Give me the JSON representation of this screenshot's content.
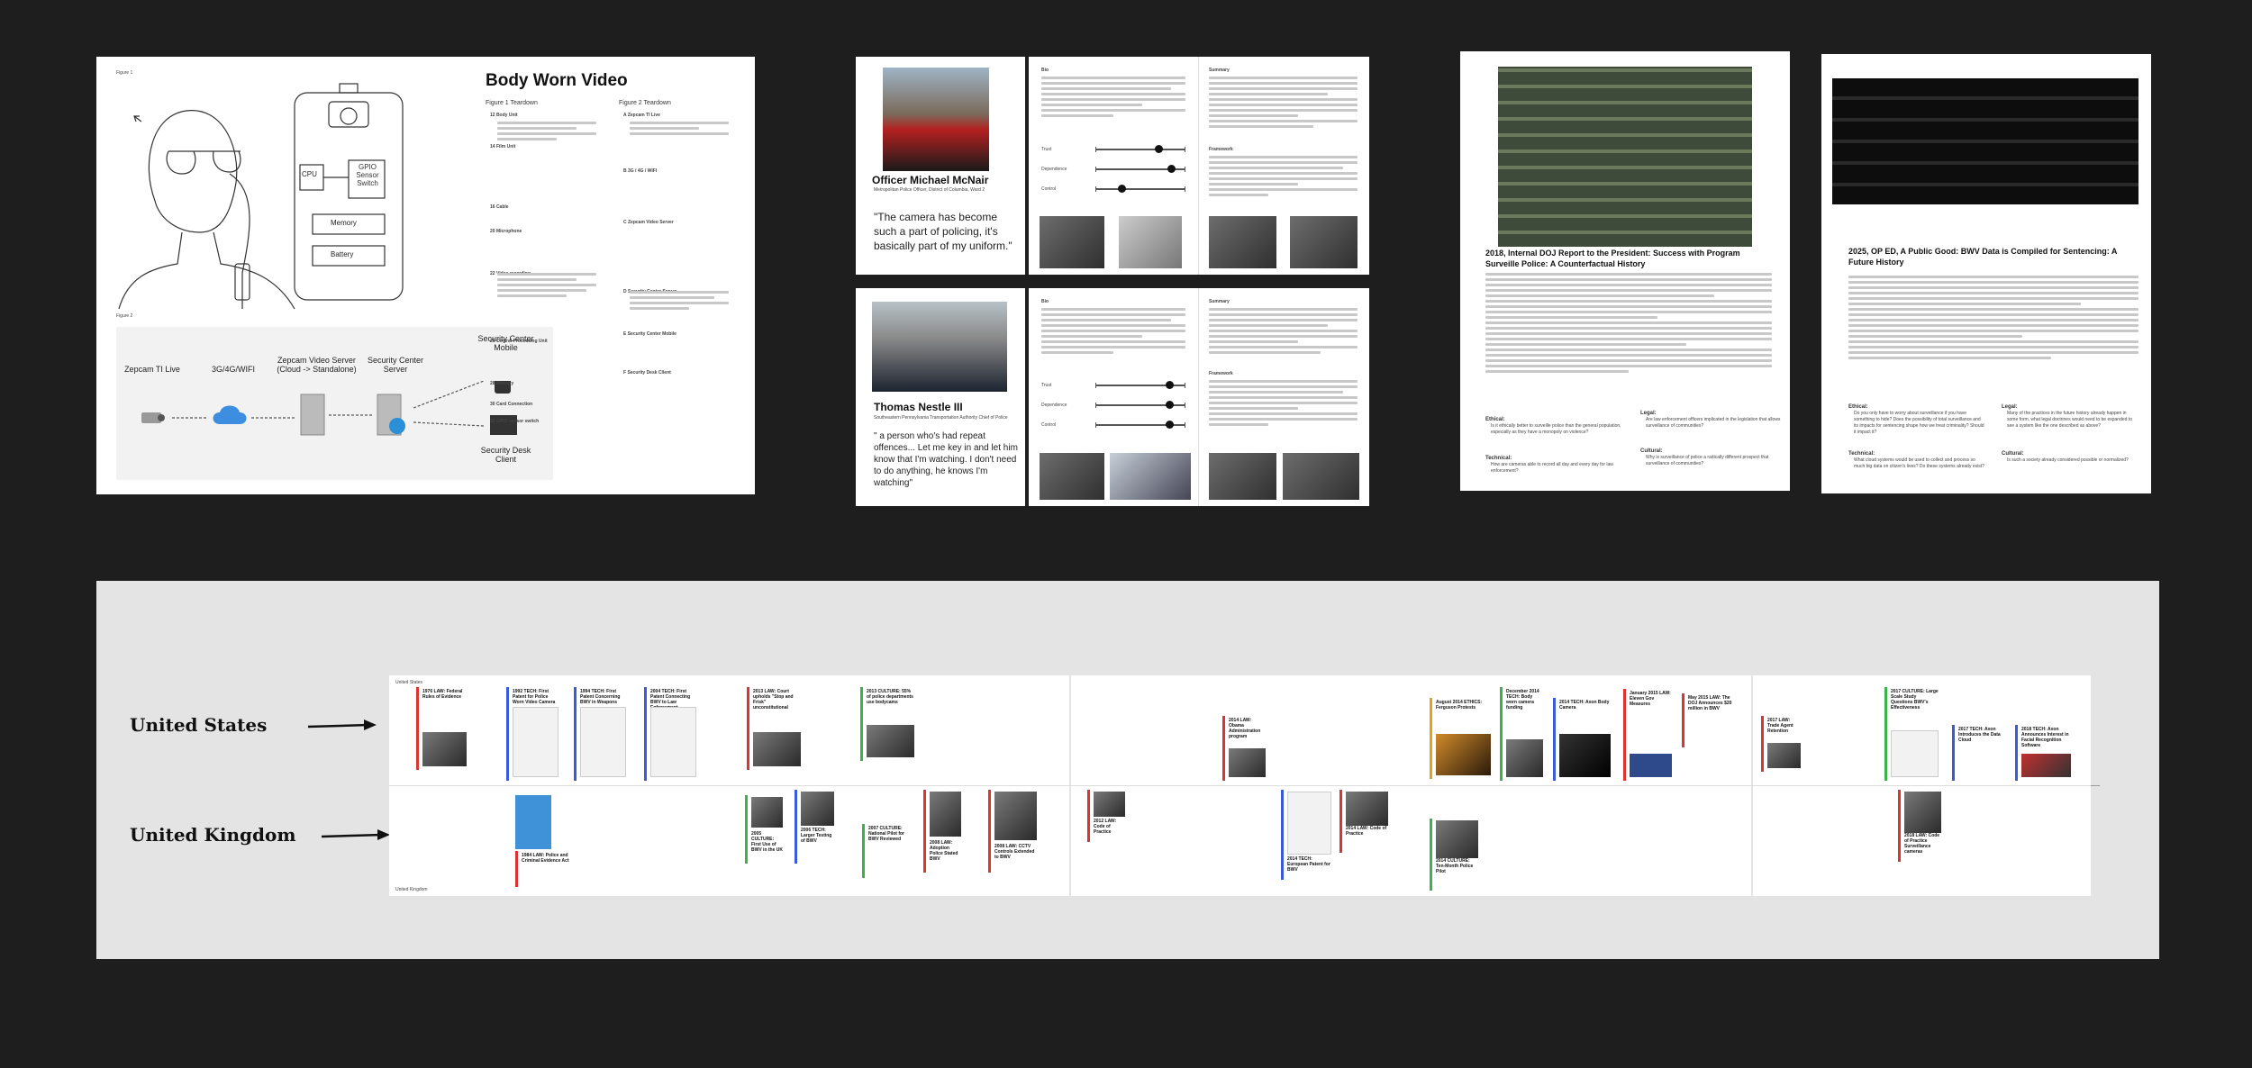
{
  "canvas": {
    "background": "#1e1e1e"
  },
  "boards": {
    "bodycam": {
      "title": "Body Worn Video",
      "figure1_label": "Figure 1",
      "figure2_label": "Figure 2",
      "col1_title": "Figure 1 Teardown",
      "col2_title": "Figure 2 Teardown",
      "col1_items": [
        "12 Body Unit",
        "14 Film Unit",
        "16 Cable",
        "20 Microphone",
        "22 Video recording",
        "26 Central Processing Unit",
        "28 Memory",
        "30 Card Connection",
        "32 GPIO sensor switch"
      ],
      "col2_items": [
        "A Zepcam TI Live",
        "B 3G / 4G / WIFI",
        "C Zepcam Video Server",
        "D Security Center Server",
        "E Security Center Mobile",
        "F Security Desk Client"
      ],
      "cpu_label": "CPU",
      "gpio_label": "GPIO Sensor Switch",
      "memory_label": "Memory",
      "battery_label": "Battery",
      "fig2_labels": {
        "live": "Zepcam TI Live",
        "net": "3G/4G/WIFI",
        "videoserver": "Zepcam Video Server (Cloud -> Standalone)",
        "centerserver": "Security Center Server",
        "mobile": "Security Center Mobile",
        "desk": "Security Desk Client"
      }
    },
    "mcnair": {
      "name": "Officer Michael McNair",
      "subtitle": "Metropolitan Police Officer, District of Columbia, Ward 2",
      "quote": "\"The camera has become such a part of policing, it's basically part of my uniform.\"",
      "bio_label": "Bio",
      "summary_label": "Summary",
      "framework_label": "Framework",
      "sliders": [
        {
          "label": "Trust",
          "value": 0.72
        },
        {
          "label": "Dependence",
          "value": 0.88
        },
        {
          "label": "Control",
          "value": 0.28
        }
      ]
    },
    "nestle": {
      "name": "Thomas Nestle III",
      "subtitle": "Southeastern Pennsylvania Transportation Authority Chief of Police",
      "quote": "\" a person who's had repeat offences... Let me key in and let him know that I'm watching. I don't need to do anything, he knows I'm watching\"",
      "bio_label": "Bio",
      "summary_label": "Summary",
      "framework_label": "Framework",
      "sliders": [
        {
          "label": "Trust",
          "value": 0.86
        },
        {
          "label": "Dependence",
          "value": 0.86
        },
        {
          "label": "Control",
          "value": 0.86
        }
      ]
    },
    "doj": {
      "title": "2018, Internal DOJ Report to the President: Success with Program Surveille Police: A Counterfactual History",
      "ethical_label": "Ethical:",
      "ethical_text": "Is it ethically better to surveille police than the general population, especially as they have a monopoly on violence?",
      "legal_label": "Legal:",
      "legal_text": "Are law enforcement officers implicated in the legislation that allows surveillance of communities?",
      "technical_label": "Technical:",
      "technical_text": "How are cameras able to record all day and every day for law enforcement?",
      "cultural_label": "Cultural:",
      "cultural_text": "Why is surveillance of police a radically different prospect that surveillance of communities?"
    },
    "oped": {
      "title": "2025, OP ED, A Public Good: BWV Data is Compiled for Sentencing: A Future History",
      "ethical_label": "Ethical:",
      "ethical_text": "Do you only have to worry about surveillance if you have something to hide? Does the possibility of total surveillance and its impacts for sentencing shape how we treat criminality? Should it impact it?",
      "legal_label": "Legal:",
      "legal_text": "Many of the practices in the future history already happen in some form, what legal doctrines would need to be expanded to see a system like the one described as above?",
      "technical_label": "Technical:",
      "technical_text": "What cloud systems would be used to collect and process so much big data on citizen's lives? Do these systems already exist?",
      "cultural_label": "Cultural:",
      "cultural_text": "Is such a society already considered possible or normalized?"
    }
  },
  "timeline": {
    "row_us": "United States",
    "row_uk": "United Kingdom",
    "corner_us": "United States",
    "corner_uk": "United Kingdom",
    "us_cards": [
      "1976 LAW: Federal Rules of Evidence",
      "1992 TECH: First Patent for Police Worn Video Camera",
      "1994 TECH: First Patent Concerning BWV in Weapons",
      "2004 TECH: First Patent Connecting BWV to Law Enforcement",
      "2013 LAW: Court upholds \"Stop and Frisk\" unconstitutional",
      "2013 CULTURE: 55% of police departments use bodycams",
      "2014 LAW: Obama Administration program",
      "August 2014 ETHICS: Ferguson Protests",
      "December 2014 TECH: Body worn camera funding",
      "2014 TECH: Axon Body Camera",
      "January 2015 LAW: Eleven Gov Measures",
      "May 2015 LAW: The DOJ Announces $20 million in BWV",
      "2017 LAW: Trade Agent Retention",
      "2017 CULTURE: Large Scale Study Questions BWV's Effectiveness",
      "2017 TECH: Axon Introduces the Data Cloud",
      "2018 TECH: Axon Announces Interest in Facial Recognition Software"
    ],
    "uk_cards": [
      "1984 LAW: Police and Criminal Evidence Act",
      "2005 CULTURE: First Use of BWV in the UK",
      "2006 TECH: Larger Testing of BWV",
      "2007 CULTURE: National Pilot for BWV Reviewed",
      "2008 LAW: Adoption Police Stated BWV",
      "2008 LAW: CCTV Controls Extended to BWV",
      "2012 LAW: Code of Practice",
      "2014 TECH: European Patent for BWV",
      "2014 LAW: Code of Practice",
      "2014 CULTURE: Ten-Month Police Pilot",
      "2018 LAW: Code of Practice Surveillance cameras"
    ]
  }
}
